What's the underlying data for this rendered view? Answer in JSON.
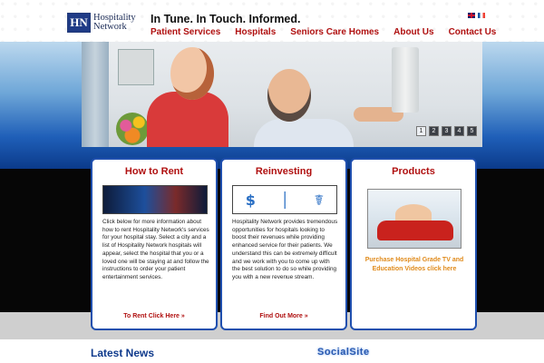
{
  "header": {
    "logo_mark": "HN",
    "logo_line1": "Hospitality",
    "logo_line2": "Network",
    "tagline": "In Tune. In Touch. Informed."
  },
  "nav": [
    {
      "label": "Patient Services"
    },
    {
      "label": "Hospitals"
    },
    {
      "label": "Seniors Care Homes"
    },
    {
      "label": "About Us"
    },
    {
      "label": "Contact Us"
    }
  ],
  "banner": {
    "pages": [
      "1",
      "2",
      "3",
      "4",
      "5"
    ]
  },
  "cards": {
    "rent": {
      "title": "How to Rent",
      "text": "Click below for more information about how to rent Hospitality Network's services for your hospital stay.  Select a city and a list of Hospitality Network hospitals will appear, select the hospital that you or a loved one will be staying at and follow the  instructions  to order your patient entertainment services.",
      "link": "To Rent Click Here »"
    },
    "reinvest": {
      "title": "Reinvesting",
      "text": "Hospitality Network provides tremendous opportunities for hospitals looking to boost their revenues while providing enhanced service for their patients.  We understand this can be extremely difficult and we work with you to come up with the best solution to do so while providing you with a new revenue stream.",
      "link": "Find Out More »",
      "symbols": [
        "$",
        "│",
        "☤"
      ]
    },
    "products": {
      "title": "Products",
      "link": "Purchase Hospital Grade TV and Education Videos click here"
    }
  },
  "bottom": {
    "news_title": "Latest News",
    "social_title": "SocialSite"
  },
  "colors": {
    "accent_red": "#b01010",
    "brand_blue": "#1f4fae",
    "link_orange": "#e08a1a"
  }
}
